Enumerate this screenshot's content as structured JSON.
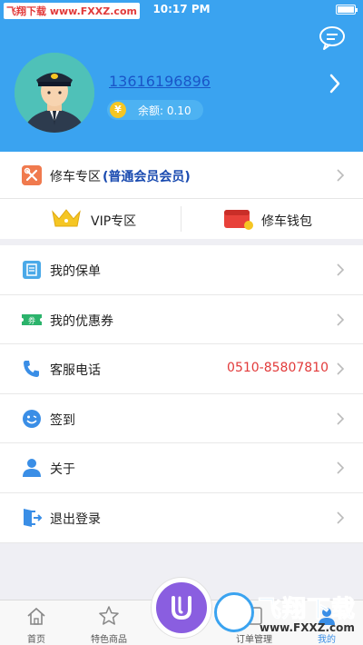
{
  "status_bar": {
    "watermark": "飞翔下载 www.FXXZ.com",
    "time": "10:17 PM"
  },
  "profile": {
    "phone": "13616196896",
    "balance": "余额: 0.10",
    "coin_symbol": "¥"
  },
  "member": {
    "label": "修车专区",
    "level": "(普通会员会员)",
    "vip_label": "VIP专区",
    "wallet_label": "修车钱包"
  },
  "menu": [
    {
      "label": "我的保单",
      "value": "",
      "icon": "policy-icon"
    },
    {
      "label": "我的优惠券",
      "value": "",
      "icon": "coupon-icon"
    },
    {
      "label": "客服电话",
      "value": "0510-85807810",
      "icon": "phone-icon"
    },
    {
      "label": "签到",
      "value": "",
      "icon": "checkin-icon"
    },
    {
      "label": "关于",
      "value": "",
      "icon": "about-icon"
    },
    {
      "label": "退出登录",
      "value": "",
      "icon": "logout-icon"
    }
  ],
  "tabs": [
    {
      "label": "首页",
      "icon": "home-icon"
    },
    {
      "label": "特色商品",
      "icon": "star-icon"
    },
    {
      "label": "订单管理",
      "icon": "orders-icon"
    },
    {
      "label": "我的",
      "icon": "profile-icon"
    }
  ],
  "watermark": {
    "title": "飞翔下载",
    "url": "www.FXXZ.com"
  },
  "colors": {
    "primary": "#3aa3f0",
    "member_level": "#1a4bb0",
    "phone_number": "#e23a3a",
    "center_tab": "#8a5ee0"
  }
}
